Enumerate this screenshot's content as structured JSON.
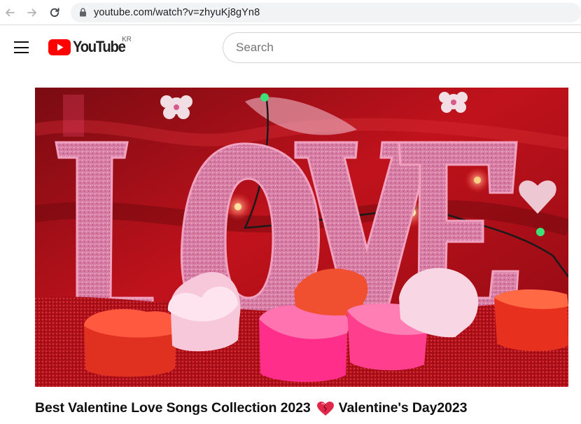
{
  "browser": {
    "url": "youtube.com/watch?v=zhyuKj8gYn8",
    "icons": [
      "back-arrow-icon",
      "forward-arrow-icon",
      "reload-icon",
      "lock-icon"
    ]
  },
  "masthead": {
    "logo_text": "YouTube",
    "country_code": "KR",
    "search_placeholder": "Search",
    "icons": [
      "hamburger-menu-icon",
      "youtube-logo-icon"
    ]
  },
  "video": {
    "thumbnail_word": "LOVE",
    "title_part1": "Best Valentine Love Songs Collection 2023",
    "title_part2": "Valentine's Day ",
    "title_part3": " 2023",
    "title_emoji": "heart-emoji-icon"
  },
  "colors": {
    "youtube_red": "#ff0000",
    "title_text": "#0f0f0f",
    "address_bar_bg": "#f1f3f4"
  }
}
